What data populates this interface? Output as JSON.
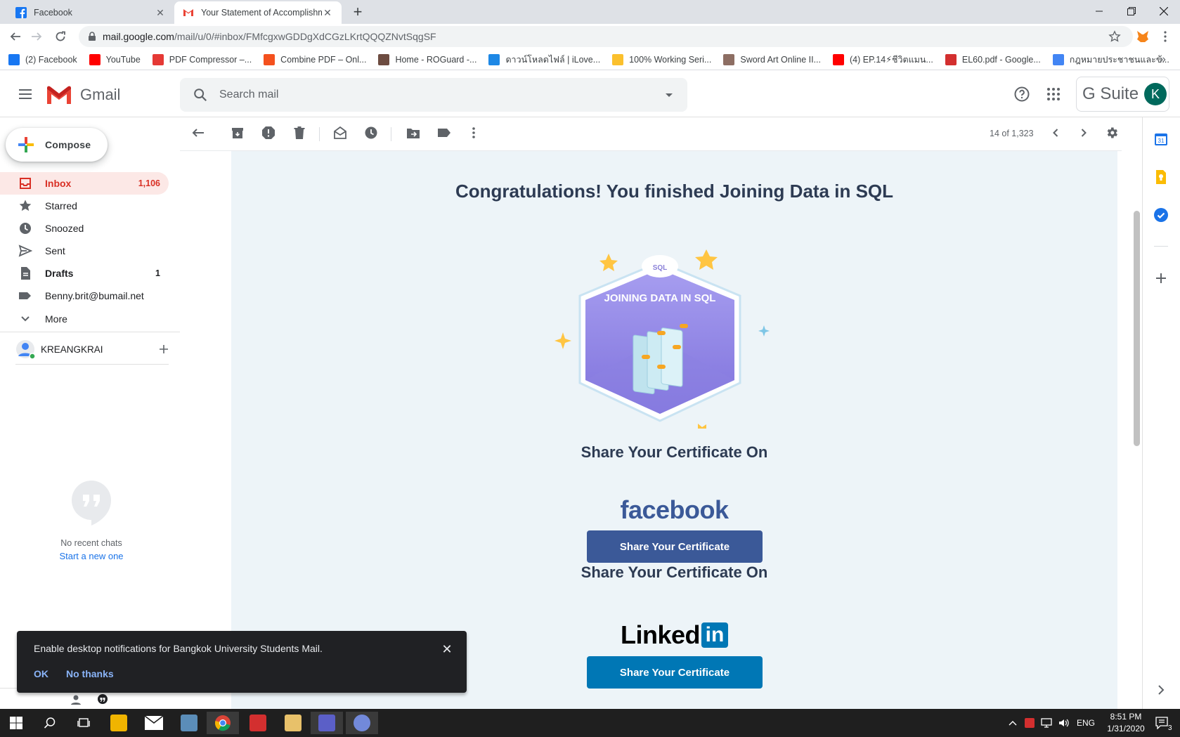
{
  "browser": {
    "tabs": [
      {
        "title": "Facebook",
        "icon": "facebook-icon",
        "active": false
      },
      {
        "title": "Your Statement of Accomplishme",
        "icon": "gmail-icon",
        "active": true
      }
    ],
    "url_host": "mail.google.com",
    "url_path": "/mail/u/0/#inbox/FMfcgxwGDDgXdCGzLKrtQQQZNvtSqgSF",
    "bookmarks": [
      {
        "label": "(2) Facebook",
        "color": "#1877f2"
      },
      {
        "label": "YouTube",
        "color": "#ff0000"
      },
      {
        "label": "PDF Compressor –...",
        "color": "#e53935"
      },
      {
        "label": "Combine PDF – Onl...",
        "color": "#f4511e"
      },
      {
        "label": "Home - ROGuard -...",
        "color": "#6d4c41"
      },
      {
        "label": "ดาวน์โหลดไฟล์ | iLove...",
        "color": "#1e88e5"
      },
      {
        "label": "100% Working Seri...",
        "color": "#fbc02d"
      },
      {
        "label": "Sword Art Online II...",
        "color": "#8d6e63"
      },
      {
        "label": "(4) EP.14⚡ชีวิตแมน...",
        "color": "#ff0000"
      },
      {
        "label": "EL60.pdf - Google...",
        "color": "#d32f2f"
      },
      {
        "label": "กฎหมายประชาชนและข้...",
        "color": "#4285f4"
      }
    ]
  },
  "gmail": {
    "product_name": "Gmail",
    "search_placeholder": "Search mail",
    "gsuite_label": "G Suite",
    "avatar_letter": "K",
    "compose_label": "Compose",
    "nav": [
      {
        "label": "Inbox",
        "count": "1,106",
        "icon": "inbox-icon",
        "active": true,
        "bold": true
      },
      {
        "label": "Starred",
        "count": "",
        "icon": "star-icon",
        "active": false,
        "bold": false
      },
      {
        "label": "Snoozed",
        "count": "",
        "icon": "clock-icon",
        "active": false,
        "bold": false
      },
      {
        "label": "Sent",
        "count": "",
        "icon": "send-icon",
        "active": false,
        "bold": false
      },
      {
        "label": "Drafts",
        "count": "1",
        "icon": "draft-icon",
        "active": false,
        "bold": true
      },
      {
        "label": "Benny.brit@bumail.net",
        "count": "",
        "icon": "label-icon",
        "active": false,
        "bold": false
      },
      {
        "label": "More",
        "count": "",
        "icon": "chevron-down-icon",
        "active": false,
        "bold": false
      }
    ],
    "user_name": "KREANGKRAI",
    "chat_empty_text": "No recent chats",
    "chat_start_link": "Start a new one",
    "pager_text": "14 of 1,323"
  },
  "email": {
    "headline": "Congratulations! You finished Joining Data in SQL",
    "badge_tag": "SQL",
    "badge_title": "JOINING DATA IN SQL",
    "share_heading_1": "Share Your Certificate On",
    "facebook_wordmark": "facebook",
    "share_button_1": "Share Your Certificate",
    "share_heading_2": "Share Your Certificate On",
    "linkedin_wordmark": "Linked",
    "linkedin_box": "in",
    "share_button_2": "Share Your Certificate",
    "colors": {
      "facebook_button": "#3b5998",
      "linkedin_button": "#0077b5",
      "heading": "#2d3b53",
      "canvas": "#edf4f8"
    }
  },
  "snackbar": {
    "message": "Enable desktop notifications for Bangkok University Students Mail.",
    "ok_label": "OK",
    "no_label": "No thanks"
  },
  "taskbar": {
    "language": "ENG",
    "time": "8:51 PM",
    "date": "1/31/2020",
    "notification_count": "3"
  }
}
